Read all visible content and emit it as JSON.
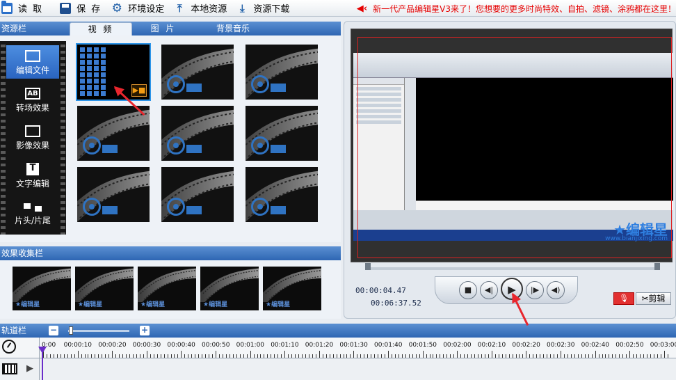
{
  "toolbar": {
    "read_label": "读 取",
    "save_label": "保 存",
    "settings_label": "环境设定",
    "local_label": "本地资源",
    "download_label": "资源下载"
  },
  "marquee": "新一代产品编辑星V3来了！您想要的更多时尚特效、自拍、滤镜、涂鸦都在这里！",
  "resources": {
    "title": "资源栏",
    "tabs": [
      "视 频",
      "图 片",
      "背景音乐"
    ],
    "side_items": [
      "编辑文件",
      "转场效果",
      "影像效果",
      "文字编辑",
      "片头/片尾"
    ]
  },
  "effects": {
    "title": "效果收集栏",
    "watermark": "编辑星"
  },
  "preview": {
    "logo": "编辑星",
    "logo_url": "www.bianjixing.com",
    "current_time": "00:00:04.47",
    "total_time": "00:06:37.52",
    "cut_label": "剪辑"
  },
  "timeline": {
    "title": "轨道栏",
    "ticks": [
      "0:00",
      "00:00:10",
      "00:00:20",
      "00:00:30",
      "00:00:40",
      "00:00:50",
      "00:01:00",
      "00:01:10",
      "00:01:20",
      "00:01:30",
      "00:01:40",
      "00:01:50",
      "00:02:00",
      "00:02:10",
      "00:02:20",
      "00:02:30",
      "00:02:40",
      "00:02:50",
      "00:03:00"
    ]
  },
  "colors": {
    "accent": "#2e66b3",
    "marquee": "#e60000",
    "annotation_arrow": "#e8262d"
  }
}
